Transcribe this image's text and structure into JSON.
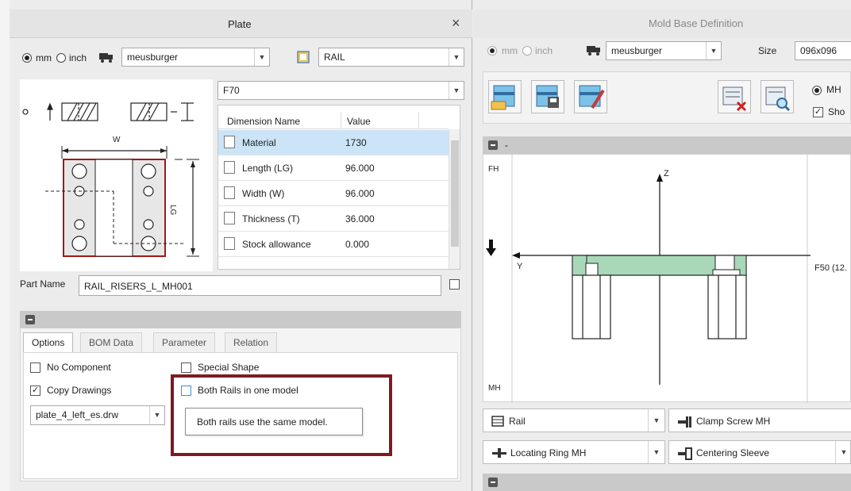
{
  "plate_dialog": {
    "title": "Plate",
    "close_glyph": "×",
    "units": {
      "mm": "mm",
      "inch": "inch",
      "selected": "mm"
    },
    "supplier": "meusburger",
    "plate_type": "RAIL",
    "plate_variant": "F70",
    "drawing_labels": {
      "width": "W",
      "length": "LG",
      "thickness": "T",
      "origin": "o"
    },
    "table": {
      "headers": [
        "Dimension Name",
        "Value"
      ],
      "rows": [
        {
          "name": "Material",
          "value": "1730"
        },
        {
          "name": "Length (LG)",
          "value": "96.000"
        },
        {
          "name": "Width (W)",
          "value": "96.000"
        },
        {
          "name": "Thickness (T)",
          "value": "36.000"
        },
        {
          "name": "Stock allowance",
          "value": "0.000"
        }
      ]
    },
    "part_name_label": "Part Name",
    "part_name_value": "RAIL_RISERS_L_MH001",
    "tabs": [
      "Options",
      "BOM Data",
      "Parameter",
      "Relation"
    ],
    "active_tab": "Options",
    "options": {
      "no_component": "No Component",
      "special_shape": "Special Shape",
      "copy_drawings": "Copy Drawings",
      "both_rails": "Both Rails in one model",
      "drawing_file": "plate_4_left_es.drw",
      "tooltip": "Both rails use the same model."
    }
  },
  "mold_dialog": {
    "title": "Mold Base Definition",
    "units": {
      "mm": "mm",
      "inch": "inch"
    },
    "supplier": "meusburger",
    "size_label": "Size",
    "size_value": "096x096",
    "side_option": "MH",
    "show_option": "Sho",
    "section_label": "-",
    "diagram": {
      "fh": "FH",
      "mh": "MH",
      "z_axis": "Z",
      "y_axis": "Y",
      "plate_label": "F50 (12."
    },
    "component_combos": [
      {
        "label": "Rail",
        "icon": "rail-icon"
      },
      {
        "label": "Clamp Screw MH",
        "icon": "clamp-screw-icon"
      },
      {
        "label": "Locating Ring MH",
        "icon": "locating-ring-icon"
      },
      {
        "label": "Centering Sleeve",
        "icon": "centering-sleeve-icon"
      }
    ]
  },
  "colors": {
    "highlight_frame": "#7d1a23",
    "selected_row": "#cce4f7",
    "plate_green": "#a8d8b8",
    "drawing_red": "#a01818"
  }
}
